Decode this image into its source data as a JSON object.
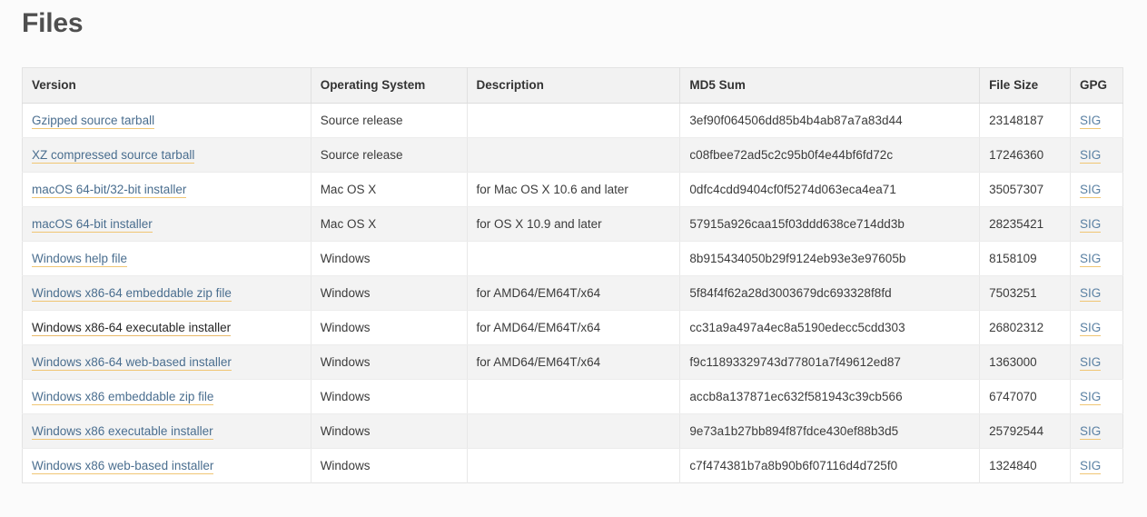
{
  "page": {
    "title": "Files"
  },
  "table": {
    "columns": [
      {
        "key": "version",
        "label": "Version"
      },
      {
        "key": "os",
        "label": "Operating System"
      },
      {
        "key": "description",
        "label": "Description"
      },
      {
        "key": "md5",
        "label": "MD5 Sum"
      },
      {
        "key": "size",
        "label": "File Size"
      },
      {
        "key": "gpg",
        "label": "GPG"
      }
    ],
    "gpg_link_label": "SIG",
    "rows": [
      {
        "version": "Gzipped source tarball",
        "os": "Source release",
        "description": "",
        "md5": "3ef90f064506dd85b4b4ab87a7a83d44",
        "size": "23148187",
        "gpg": "SIG",
        "state": "normal"
      },
      {
        "version": "XZ compressed source tarball",
        "os": "Source release",
        "description": "",
        "md5": "c08fbee72ad5c2c95b0f4e44bf6fd72c",
        "size": "17246360",
        "gpg": "SIG",
        "state": "normal"
      },
      {
        "version": "macOS 64-bit/32-bit installer",
        "os": "Mac OS X",
        "description": "for Mac OS X 10.6 and later",
        "md5": "0dfc4cdd9404cf0f5274d063eca4ea71",
        "size": "35057307",
        "gpg": "SIG",
        "state": "normal"
      },
      {
        "version": "macOS 64-bit installer",
        "os": "Mac OS X",
        "description": "for OS X 10.9 and later",
        "md5": "57915a926caa15f03ddd638ce714dd3b",
        "size": "28235421",
        "gpg": "SIG",
        "state": "normal"
      },
      {
        "version": "Windows help file",
        "os": "Windows",
        "description": "",
        "md5": "8b915434050b29f9124eb93e3e97605b",
        "size": "8158109",
        "gpg": "SIG",
        "state": "normal"
      },
      {
        "version": "Windows x86-64 embeddable zip file",
        "os": "Windows",
        "description": "for AMD64/EM64T/x64",
        "md5": "5f84f4f62a28d3003679dc693328f8fd",
        "size": "7503251",
        "gpg": "SIG",
        "state": "normal"
      },
      {
        "version": "Windows x86-64 executable installer",
        "os": "Windows",
        "description": "for AMD64/EM64T/x64",
        "md5": "cc31a9a497a4ec8a5190edecc5cdd303",
        "size": "26802312",
        "gpg": "SIG",
        "state": "hovered"
      },
      {
        "version": "Windows x86-64 web-based installer",
        "os": "Windows",
        "description": "for AMD64/EM64T/x64",
        "md5": "f9c11893329743d77801a7f49612ed87",
        "size": "1363000",
        "gpg": "SIG",
        "state": "normal"
      },
      {
        "version": "Windows x86 embeddable zip file",
        "os": "Windows",
        "description": "",
        "md5": "accb8a137871ec632f581943c39cb566",
        "size": "6747070",
        "gpg": "SIG",
        "state": "normal"
      },
      {
        "version": "Windows x86 executable installer",
        "os": "Windows",
        "description": "",
        "md5": "9e73a1b27bb894f87fdce430ef88b3d5",
        "size": "25792544",
        "gpg": "SIG",
        "state": "normal"
      },
      {
        "version": "Windows x86 web-based installer",
        "os": "Windows",
        "description": "",
        "md5": "c7f474381b7a8b90b6f07116d4d725f0",
        "size": "1324840",
        "gpg": "SIG",
        "state": "normal"
      }
    ]
  },
  "colors": {
    "page_background": "#fbfbfb",
    "heading": "#4f4f4f",
    "link": "#4a6e8f",
    "link_hover": "#262626",
    "link_underline": "#f0c674",
    "header_background": "#f2f2f2",
    "row_alt_background": "#f3f3f3",
    "border": "#e3e3e3"
  }
}
